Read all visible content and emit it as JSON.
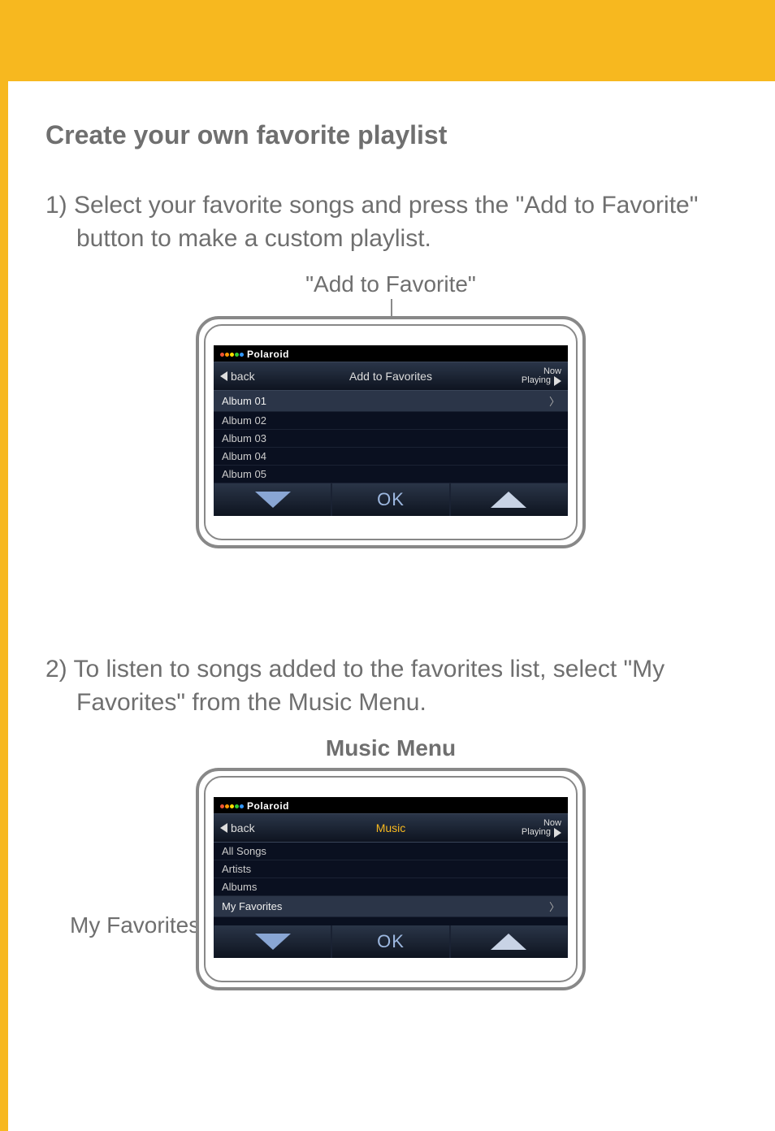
{
  "heading": "Create your own favorite playlist",
  "step1": "1) Select your favorite songs and press the \"Add to Favorite\" button to make a custom playlist.",
  "step2": "2) To listen to songs added to the favorites list, select \"My Favorites\" from the Music Menu.",
  "callout_add_fav": "\"Add to Favorite\"",
  "callout_music_menu": "Music Menu",
  "callout_my_fav": "My Favorites",
  "brand": "Polaroid",
  "device1": {
    "header": {
      "back": "back",
      "title": "Add to Favorites",
      "now": "Now",
      "playing": "Playing"
    },
    "rows": [
      "Album 01",
      "Album 02",
      "Album 03",
      "Album 04",
      "Album 05"
    ],
    "selected_index": 0,
    "ok": "OK"
  },
  "device2": {
    "header": {
      "back": "back",
      "title": "Music",
      "now": "Now",
      "playing": "Playing"
    },
    "rows": [
      "All Songs",
      "Artists",
      "Albums",
      "My Favorites"
    ],
    "selected_index": 3,
    "ok": "OK"
  }
}
